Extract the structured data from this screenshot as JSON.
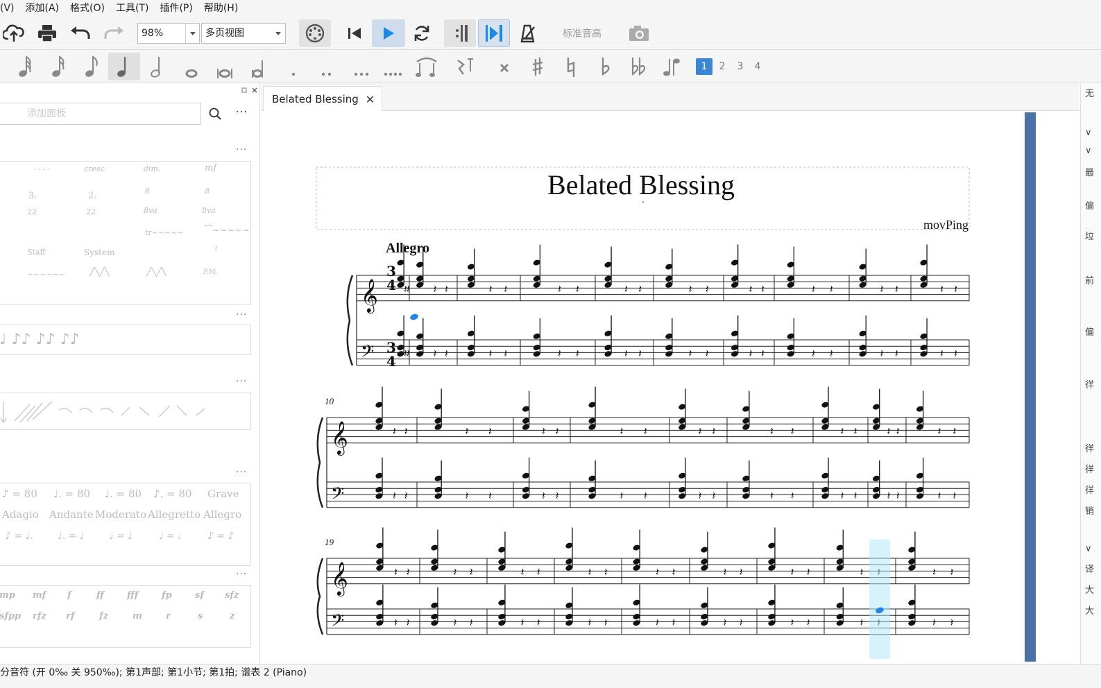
{
  "menubar": {
    "items": [
      "(V)",
      "添加(A)",
      "格式(O)",
      "工具(T)",
      "插件(P)",
      "帮助(H)"
    ]
  },
  "toolbar": {
    "zoom_value": "98%",
    "view_mode": "多页视图",
    "pitch_label": "标准音高",
    "icons": [
      "cloud-upload-icon",
      "print-icon",
      "undo-icon",
      "redo-icon",
      "midi-input-icon",
      "rewind-icon",
      "play-icon",
      "loop-icon",
      "repeat-playback-icon",
      "pan-score-icon",
      "metronome-icon",
      "camera-icon"
    ],
    "accent": "#1e88e5"
  },
  "notebar": {
    "voices": [
      "1",
      "2",
      "3",
      "4"
    ]
  },
  "palette": {
    "search_placeholder": "添加面板",
    "more": "···",
    "dots": "···",
    "lines_items": [
      "3.",
      "2.",
      "8",
      "8",
      "22",
      "22",
      "8va",
      "8va",
      "Staff",
      "System",
      "P.M."
    ],
    "dynamics_top": [
      "mf"
    ],
    "tempo_row1": [
      "♪ = 80",
      "♩. = 80",
      "♩. = 80",
      "♪. = 80",
      "Grave"
    ],
    "tempo_row2": [
      "Adagio",
      "Andante",
      "Moderato",
      "Allegretto",
      "Allegro"
    ],
    "tempo_row3": [
      "♪ = ♩.",
      "♩. = ♩",
      "♩ = ♩",
      "♩ = 𝅗𝅥",
      "♪ = ♪"
    ],
    "dyn_row1": [
      "mp",
      "mf",
      "f",
      "ff",
      "fff",
      "fp",
      "sf",
      "sfz"
    ],
    "dyn_row2": [
      "sfpp",
      "rfz",
      "rf",
      "fz",
      "m",
      "r",
      "s",
      "z"
    ]
  },
  "tab": {
    "title": "Belated Blessing",
    "close": "✕"
  },
  "score": {
    "title": "Belated Blessing",
    "subtitle": ".",
    "composer": "movPing",
    "tempo_marking": "Allegro",
    "time_signature": "3/4",
    "system_numbers": [
      "10",
      "19"
    ]
  },
  "status": {
    "text": "分音符 (开 0‰ 关 950‰); 第1声部;  第1小节; 第1拍; 谱表 2 (Piano)"
  }
}
